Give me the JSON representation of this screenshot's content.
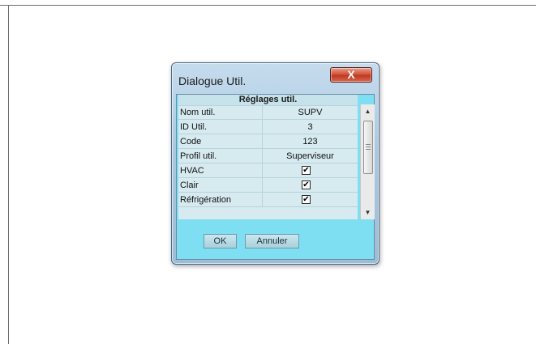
{
  "dialog": {
    "title": "Dialogue Util.",
    "close_label": "X",
    "table_header": "Réglages util.",
    "rows": [
      {
        "label": "Nom util.",
        "value": "SUPV",
        "type": "text"
      },
      {
        "label": "ID Util.",
        "value": "3",
        "type": "text"
      },
      {
        "label": "Code",
        "value": "123",
        "type": "text"
      },
      {
        "label": "Profil util.",
        "value": "Superviseur",
        "type": "text"
      },
      {
        "label": "HVAC",
        "value": "✔",
        "type": "checkbox"
      },
      {
        "label": "Clair",
        "value": "✔",
        "type": "checkbox"
      },
      {
        "label": "Réfrigération",
        "value": "✔",
        "type": "checkbox"
      }
    ],
    "scroll_up": "▲",
    "scroll_down": "▼",
    "ok_label": "OK",
    "cancel_label": "Annuler"
  }
}
